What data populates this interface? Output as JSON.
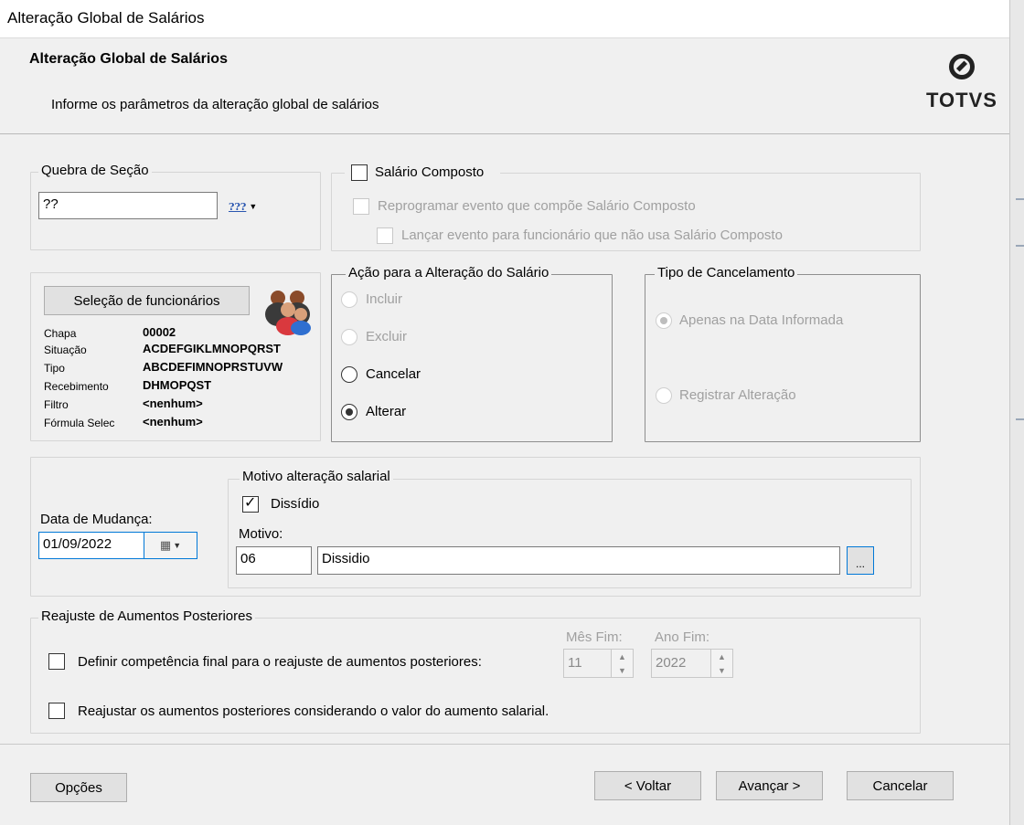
{
  "window": {
    "title": "Alteração Global de Salários"
  },
  "header": {
    "title": "Alteração Global de Salários",
    "subtitle": "Informe os parâmetros da alteração global de salários",
    "logo_text": "TOTVS"
  },
  "quebra": {
    "label": "Quebra de Seção",
    "value": "??",
    "dropdown_glyph": "???"
  },
  "salario_composto": {
    "label": "Salário Composto",
    "checked": false,
    "reprogramar_label": "Reprogramar evento que compõe Salário Composto",
    "lancar_label": "Lançar evento para funcionário que não usa Salário Composto"
  },
  "selecao": {
    "button_label": "Seleção de funcionários",
    "fields": [
      {
        "key": "Chapa",
        "value": "00002"
      },
      {
        "key": "Situação",
        "value": "ACDEFGIKLMNOPQRST"
      },
      {
        "key": "Tipo",
        "value": "ABCDEFIMNOPRSTUVW"
      },
      {
        "key": "Recebimento",
        "value": "DHMOPQST"
      },
      {
        "key": "Filtro",
        "value": "<nenhum>"
      },
      {
        "key": "Fórmula Selec",
        "value": "<nenhum>"
      }
    ]
  },
  "acao": {
    "label": "Ação para a Alteração do Salário",
    "options": [
      "Incluir",
      "Excluir",
      "Cancelar",
      "Alterar"
    ],
    "selected": "Alterar"
  },
  "cancelamento": {
    "label": "Tipo de Cancelamento",
    "options": [
      "Apenas na Data Informada",
      "Registrar Alteração"
    ],
    "selected": "Apenas na Data Informada"
  },
  "mudanca": {
    "label": "Data de Mudança:",
    "value": "01/09/2022"
  },
  "motivo": {
    "group_label": "Motivo alteração salarial",
    "dissidio_label": "Dissídio",
    "dissidio_checked": true,
    "motivo_label": "Motivo:",
    "code": "06",
    "description": "Dissidio",
    "browse_label": "..."
  },
  "reajuste": {
    "group_label": "Reajuste de Aumentos Posteriores",
    "definir_label": "Definir competência final para o reajuste de aumentos posteriores:",
    "mes_label": "Mês Fim:",
    "mes_value": "11",
    "ano_label": "Ano Fim:",
    "ano_value": "2022",
    "reajustar_label": "Reajustar os aumentos posteriores considerando o valor do aumento salarial."
  },
  "footer": {
    "opcoes": "Opções",
    "voltar": "< Voltar",
    "avancar": "Avançar >",
    "cancelar": "Cancelar"
  }
}
